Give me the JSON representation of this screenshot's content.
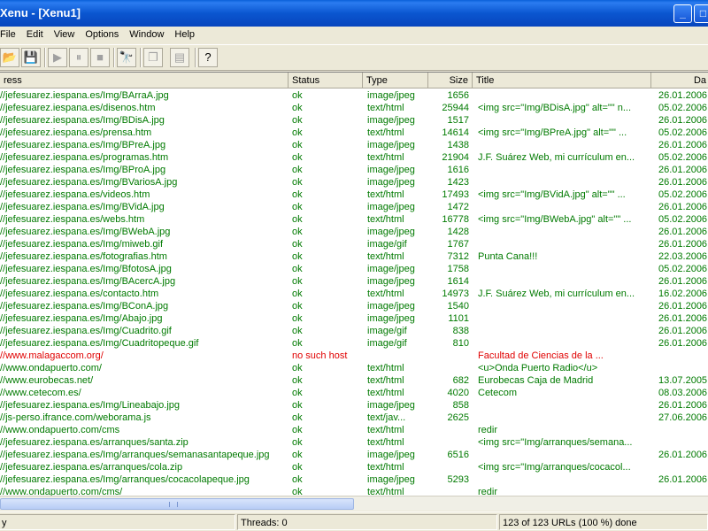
{
  "window": {
    "title": "Xenu - [Xenu1]",
    "minimize_glyph": "_",
    "maximize_glyph": "□"
  },
  "menu": [
    "File",
    "Edit",
    "View",
    "Options",
    "Window",
    "Help"
  ],
  "toolbar": {
    "buttons": [
      {
        "name": "open-folder-icon",
        "glyph": "📂",
        "enabled": true
      },
      {
        "name": "save-icon",
        "glyph": "💾",
        "enabled": true
      },
      {
        "name": "play-icon",
        "glyph": "▶",
        "enabled": false
      },
      {
        "name": "pause-icon",
        "glyph": "⏸",
        "enabled": false
      },
      {
        "name": "stop-icon",
        "glyph": "■",
        "enabled": false
      },
      {
        "name": "binoculars-icon",
        "glyph": "🔭",
        "enabled": true
      },
      {
        "name": "copy-icon",
        "glyph": "❐",
        "enabled": false
      },
      {
        "name": "properties-icon",
        "glyph": "▤",
        "enabled": false
      },
      {
        "name": "help-icon",
        "glyph": "?",
        "enabled": true
      }
    ]
  },
  "columns": {
    "address": "ress",
    "status": "Status",
    "type": "Type",
    "size": "Size",
    "title": "Title",
    "date": "Da"
  },
  "rows": [
    {
      "address": "//jefesuarez.iespana.es/Img/BArraA.jpg",
      "status": "ok",
      "type": "image/jpeg",
      "size": "1656",
      "title": "",
      "date": "26.01.2006",
      "error": false
    },
    {
      "address": "//jefesuarez.iespana.es/disenos.htm",
      "status": "ok",
      "type": "text/html",
      "size": "25944",
      "title": "<img src=\"Img/BDisA.jpg\" alt=\"\" n...",
      "date": "05.02.2006",
      "error": false
    },
    {
      "address": "//jefesuarez.iespana.es/Img/BDisA.jpg",
      "status": "ok",
      "type": "image/jpeg",
      "size": "1517",
      "title": "",
      "date": "26.01.2006",
      "error": false
    },
    {
      "address": "//jefesuarez.iespana.es/prensa.htm",
      "status": "ok",
      "type": "text/html",
      "size": "14614",
      "title": "<img src=\"Img/BPreA.jpg\" alt=\"\" ...",
      "date": "05.02.2006",
      "error": false
    },
    {
      "address": "//jefesuarez.iespana.es/Img/BPreA.jpg",
      "status": "ok",
      "type": "image/jpeg",
      "size": "1438",
      "title": "",
      "date": "26.01.2006",
      "error": false
    },
    {
      "address": "//jefesuarez.iespana.es/programas.htm",
      "status": "ok",
      "type": "text/html",
      "size": "21904",
      "title": "J.F. Suárez Web, mi currículum en...",
      "date": "05.02.2006",
      "error": false
    },
    {
      "address": "//jefesuarez.iespana.es/Img/BProA.jpg",
      "status": "ok",
      "type": "image/jpeg",
      "size": "1616",
      "title": "",
      "date": "26.01.2006",
      "error": false
    },
    {
      "address": "//jefesuarez.iespana.es/Img/BVariosA.jpg",
      "status": "ok",
      "type": "image/jpeg",
      "size": "1423",
      "title": "",
      "date": "26.01.2006",
      "error": false
    },
    {
      "address": "//jefesuarez.iespana.es/videos.htm",
      "status": "ok",
      "type": "text/html",
      "size": "17493",
      "title": "<img src=\"Img/BVidA.jpg\" alt=\"\" ...",
      "date": "05.02.2006",
      "error": false
    },
    {
      "address": "//jefesuarez.iespana.es/Img/BVidA.jpg",
      "status": "ok",
      "type": "image/jpeg",
      "size": "1472",
      "title": "",
      "date": "26.01.2006",
      "error": false
    },
    {
      "address": "//jefesuarez.iespana.es/webs.htm",
      "status": "ok",
      "type": "text/html",
      "size": "16778",
      "title": "<img src=\"Img/BWebA.jpg\" alt=\"\" ...",
      "date": "05.02.2006",
      "error": false
    },
    {
      "address": "//jefesuarez.iespana.es/Img/BWebA.jpg",
      "status": "ok",
      "type": "image/jpeg",
      "size": "1428",
      "title": "",
      "date": "26.01.2006",
      "error": false
    },
    {
      "address": "//jefesuarez.iespana.es/Img/miweb.gif",
      "status": "ok",
      "type": "image/gif",
      "size": "1767",
      "title": "",
      "date": "26.01.2006",
      "error": false
    },
    {
      "address": "//jefesuarez.iespana.es/fotografias.htm",
      "status": "ok",
      "type": "text/html",
      "size": "7312",
      "title": "Punta Cana!!!",
      "date": "22.03.2006",
      "error": false
    },
    {
      "address": "//jefesuarez.iespana.es/Img/BfotosA.jpg",
      "status": "ok",
      "type": "image/jpeg",
      "size": "1758",
      "title": "",
      "date": "05.02.2006",
      "error": false
    },
    {
      "address": "//jefesuarez.iespana.es/Img/BAcercA.jpg",
      "status": "ok",
      "type": "image/jpeg",
      "size": "1614",
      "title": "",
      "date": "26.01.2006",
      "error": false
    },
    {
      "address": "//jefesuarez.iespana.es/contacto.htm",
      "status": "ok",
      "type": "text/html",
      "size": "14973",
      "title": "J.F. Suárez Web, mi currículum en...",
      "date": "16.02.2006",
      "error": false
    },
    {
      "address": "//jefesuarez.iespana.es/Img/BConA.jpg",
      "status": "ok",
      "type": "image/jpeg",
      "size": "1540",
      "title": "",
      "date": "26.01.2006",
      "error": false
    },
    {
      "address": "//jefesuarez.iespana.es/Img/Abajo.jpg",
      "status": "ok",
      "type": "image/jpeg",
      "size": "1101",
      "title": "",
      "date": "26.01.2006",
      "error": false
    },
    {
      "address": "//jefesuarez.iespana.es/Img/Cuadrito.gif",
      "status": "ok",
      "type": "image/gif",
      "size": "838",
      "title": "",
      "date": "26.01.2006",
      "error": false
    },
    {
      "address": "//jefesuarez.iespana.es/Img/Cuadritopeque.gif",
      "status": "ok",
      "type": "image/gif",
      "size": "810",
      "title": "",
      "date": "26.01.2006",
      "error": false
    },
    {
      "address": "//www.malagaccom.org/",
      "status": "no such host",
      "type": "",
      "size": "",
      "title": "Facultad           de Ciencias de la ...",
      "date": "",
      "error": true
    },
    {
      "address": "//www.ondapuerto.com/",
      "status": "ok",
      "type": "text/html",
      "size": "",
      "title": "<u>Onda              Puerto Radio</u>",
      "date": "",
      "error": false
    },
    {
      "address": "//www.eurobecas.net/",
      "status": "ok",
      "type": "text/html",
      "size": "682",
      "title": "Eurobecas Caja de              Madrid",
      "date": "13.07.2005",
      "error": false
    },
    {
      "address": "//www.cetecom.es/",
      "status": "ok",
      "type": "text/html",
      "size": "4020",
      "title": "Cetecom",
      "date": "08.03.2006",
      "error": false
    },
    {
      "address": "//jefesuarez.iespana.es/Img/Lineabajo.jpg",
      "status": "ok",
      "type": "image/jpeg",
      "size": "858",
      "title": "",
      "date": "26.01.2006",
      "error": false
    },
    {
      "address": "//js-perso.ifrance.com/weborama.js",
      "status": "ok",
      "type": "text/jav...",
      "size": "2625",
      "title": "",
      "date": "27.06.2006",
      "error": false
    },
    {
      "address": "//www.ondapuerto.com/cms",
      "status": "ok",
      "type": "text/html",
      "size": "",
      "title": "redir",
      "date": "",
      "error": false
    },
    {
      "address": "//jefesuarez.iespana.es/arranques/santa.zip",
      "status": "ok",
      "type": "text/html",
      "size": "",
      "title": "<img src=\"Img/arranques/semana...",
      "date": "",
      "error": false
    },
    {
      "address": "//jefesuarez.iespana.es/Img/arranques/semanasantapeque.jpg",
      "status": "ok",
      "type": "image/jpeg",
      "size": "6516",
      "title": "",
      "date": "26.01.2006",
      "error": false
    },
    {
      "address": "//jefesuarez.iespana.es/arranques/cola.zip",
      "status": "ok",
      "type": "text/html",
      "size": "",
      "title": "<img src=\"Img/arranques/cocacol...",
      "date": "",
      "error": false
    },
    {
      "address": "//jefesuarez.iespana.es/Img/arranques/cocacolapeque.jpg",
      "status": "ok",
      "type": "image/jpeg",
      "size": "5293",
      "title": "",
      "date": "26.01.2006",
      "error": false
    },
    {
      "address": "//www.ondapuerto.com/cms/",
      "status": "ok",
      "type": "text/html",
      "size": "",
      "title": "redir",
      "date": "",
      "error": false
    }
  ],
  "colors": {
    "ok_text": "#007a00",
    "error_text": "#e00000"
  },
  "status_bar": {
    "left": "y",
    "threads": "Threads: 0",
    "progress": "123 of 123 URLs (100 %) done"
  }
}
